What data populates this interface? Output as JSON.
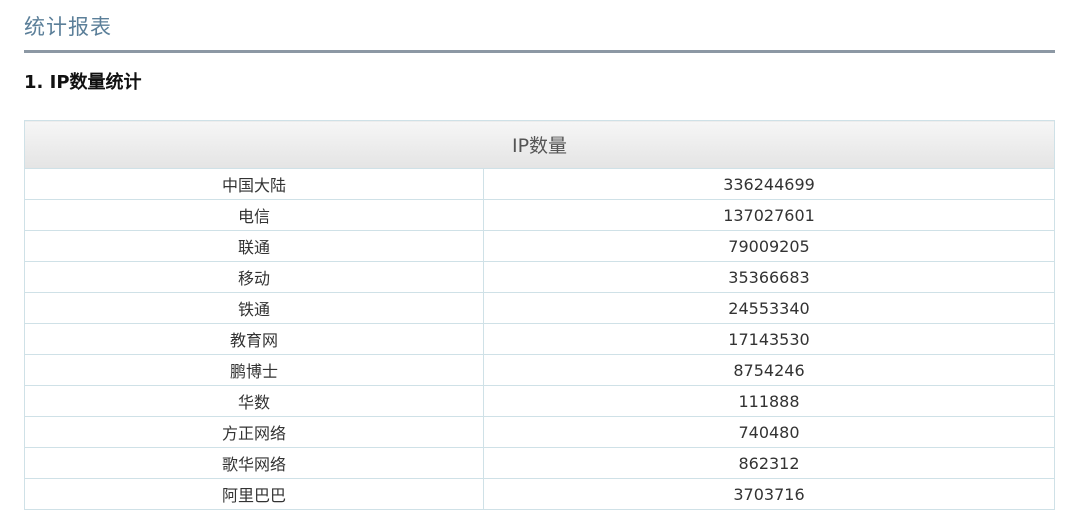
{
  "page": {
    "title": "统计报表"
  },
  "section": {
    "heading": "1. IP数量统计"
  },
  "table": {
    "header": "IP数量",
    "rows": [
      {
        "name": "中国大陆",
        "value": "336244699"
      },
      {
        "name": "电信",
        "value": "137027601"
      },
      {
        "name": "联通",
        "value": "79009205"
      },
      {
        "name": "移动",
        "value": "35366683"
      },
      {
        "name": "铁通",
        "value": "24553340"
      },
      {
        "name": "教育网",
        "value": "17143530"
      },
      {
        "name": "鹏博士",
        "value": "8754246"
      },
      {
        "name": "华数",
        "value": "111888"
      },
      {
        "name": "方正网络",
        "value": "740480"
      },
      {
        "name": "歌华网络",
        "value": "862312"
      },
      {
        "name": "阿里巴巴",
        "value": "3703716"
      }
    ]
  }
}
